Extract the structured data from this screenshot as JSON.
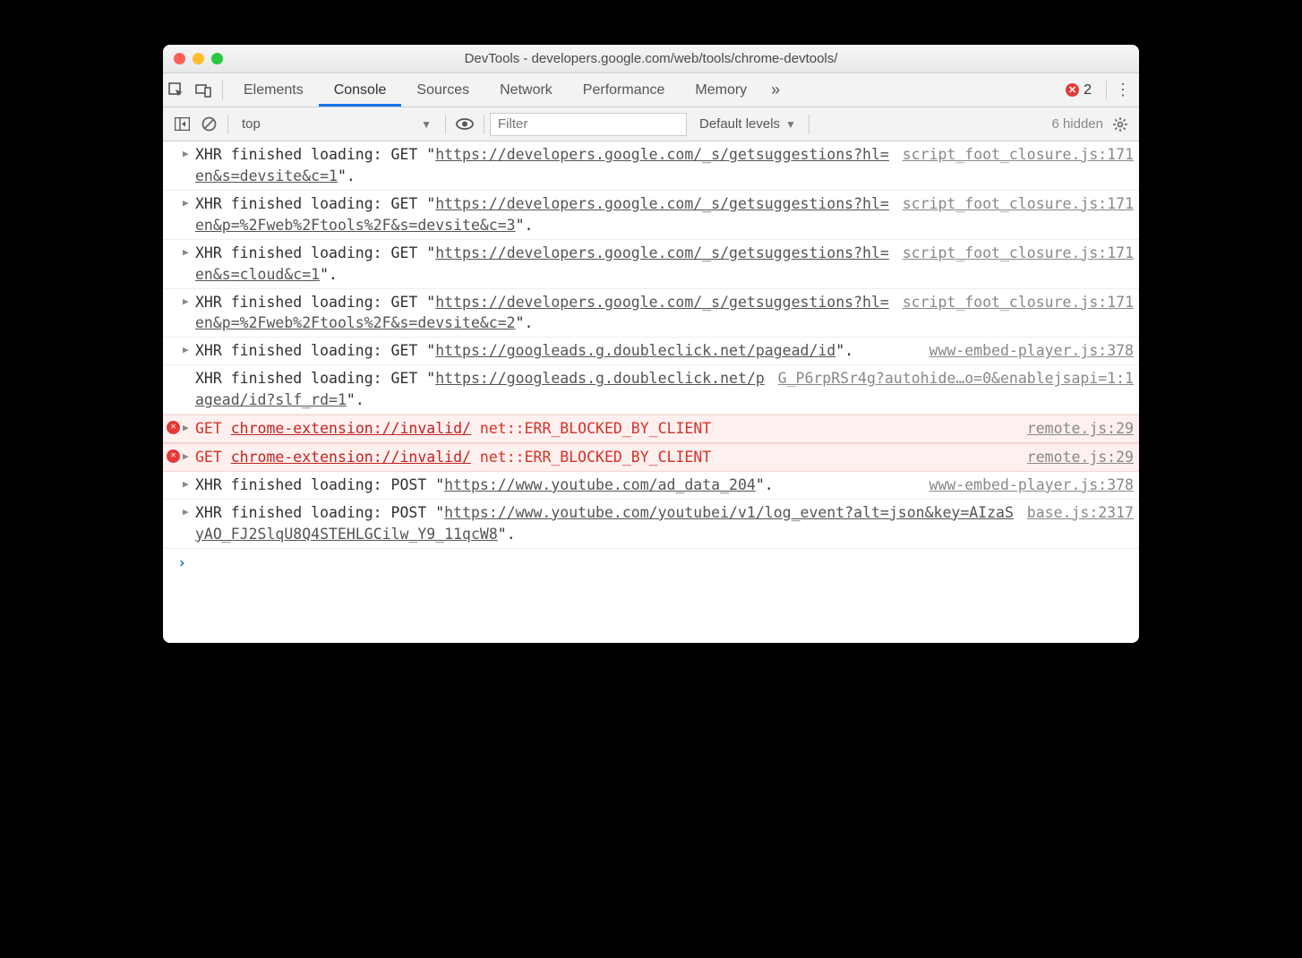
{
  "window": {
    "title": "DevTools - developers.google.com/web/tools/chrome-devtools/"
  },
  "tabs": {
    "items": [
      "Elements",
      "Console",
      "Sources",
      "Network",
      "Performance",
      "Memory"
    ],
    "active": "Console",
    "overflow_glyph": "»",
    "error_count": "2"
  },
  "toolbar": {
    "context": "top",
    "filter_placeholder": "Filter",
    "levels_label": "Default levels",
    "hidden_label": "6 hidden"
  },
  "logs": [
    {
      "type": "xhr",
      "disclose": true,
      "prefix": "XHR finished loading: GET \"",
      "url": "https://developers.google.com/_s/getsuggestions?hl=en&s=devsite&c=1",
      "suffix": "\".",
      "source": "script_foot_closure.js:171"
    },
    {
      "type": "xhr",
      "disclose": true,
      "prefix": "XHR finished loading: GET \"",
      "url": "https://developers.google.com/_s/getsuggestions?hl=en&p=%2Fweb%2Ftools%2F&s=devsite&c=3",
      "suffix": "\".",
      "source": "script_foot_closure.js:171"
    },
    {
      "type": "xhr",
      "disclose": true,
      "prefix": "XHR finished loading: GET \"",
      "url": "https://developers.google.com/_s/getsuggestions?hl=en&s=cloud&c=1",
      "suffix": "\".",
      "source": "script_foot_closure.js:171"
    },
    {
      "type": "xhr",
      "disclose": true,
      "prefix": "XHR finished loading: GET \"",
      "url": "https://developers.google.com/_s/getsuggestions?hl=en&p=%2Fweb%2Ftools%2F&s=devsite&c=2",
      "suffix": "\".",
      "source": "script_foot_closure.js:171"
    },
    {
      "type": "xhr",
      "disclose": true,
      "prefix": "XHR finished loading: GET \"",
      "url": "https://googleads.g.doubleclick.net/pagead/id",
      "suffix": "\".",
      "source": "www-embed-player.js:378"
    },
    {
      "type": "xhr",
      "disclose": false,
      "prefix": "XHR finished loading: GET \"",
      "url": "https://googleads.g.doubleclick.net/pagead/id?slf_rd=1",
      "suffix": "\".",
      "source": "G_P6rpRSr4g?autohide…o=0&enablejsapi=1:1"
    },
    {
      "type": "error",
      "disclose": true,
      "method": "GET",
      "err_url": "chrome-extension://invalid/",
      "err_text": "net::ERR_BLOCKED_BY_CLIENT",
      "source": "remote.js:29"
    },
    {
      "type": "error",
      "disclose": true,
      "method": "GET",
      "err_url": "chrome-extension://invalid/",
      "err_text": "net::ERR_BLOCKED_BY_CLIENT",
      "source": "remote.js:29"
    },
    {
      "type": "xhr",
      "disclose": true,
      "prefix": "XHR finished loading: POST \"",
      "url": "https://www.youtube.com/ad_data_204",
      "suffix": "\".",
      "source": "www-embed-player.js:378"
    },
    {
      "type": "xhr",
      "disclose": true,
      "prefix": "XHR finished loading: POST \"",
      "url": "https://www.youtube.com/youtubei/v1/log_event?alt=json&key=AIzaSyAO_FJ2SlqU8Q4STEHLGCilw_Y9_11qcW8",
      "suffix": "\".",
      "source": "base.js:2317"
    }
  ]
}
